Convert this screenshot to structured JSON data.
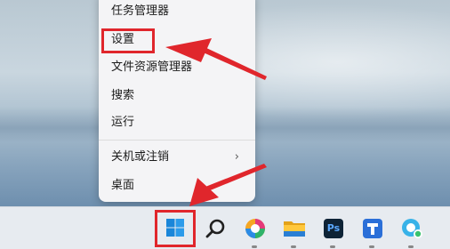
{
  "context_menu": {
    "items": [
      {
        "label": "任务管理器"
      },
      {
        "label": "设置"
      },
      {
        "label": "文件资源管理器"
      },
      {
        "label": "搜索"
      },
      {
        "label": "运行"
      },
      {
        "label": "关机或注销",
        "submenu_icon": "chevron-right-icon"
      },
      {
        "label": "桌面"
      }
    ],
    "highlighted": "设置"
  },
  "taskbar": {
    "icons": [
      {
        "name": "start-button"
      },
      {
        "name": "search"
      },
      {
        "name": "copilot"
      },
      {
        "name": "file-explorer"
      },
      {
        "name": "photoshop",
        "label": "Ps"
      },
      {
        "name": "app-blue"
      },
      {
        "name": "chat-app"
      }
    ]
  },
  "annotation": {
    "color": "#e0262c"
  }
}
